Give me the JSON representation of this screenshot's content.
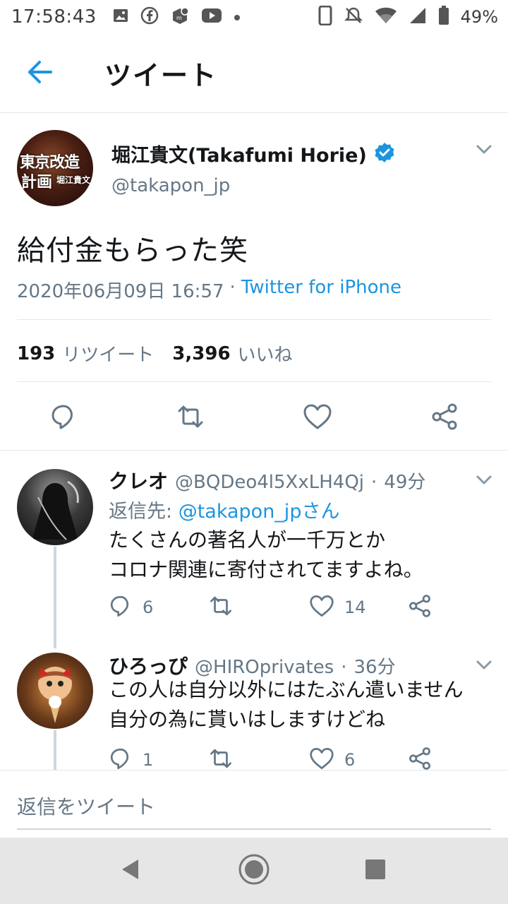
{
  "status_bar": {
    "time": "17:58:43",
    "battery": "49%",
    "icons": [
      "gallery-icon",
      "facebook-icon",
      "shop-icon",
      "youtube-icon",
      "dot-icon",
      "phone-icon",
      "mute-icon",
      "wifi-icon",
      "signal-icon",
      "battery-icon"
    ]
  },
  "header": {
    "title": "ツイート",
    "back_icon": "back-arrow-icon"
  },
  "main_tweet": {
    "avatar_text_1": "東京改造",
    "avatar_text_2": "計画",
    "avatar_text_3": "堀江貴文",
    "name": "堀江貴文(Takafumi Horie)",
    "handle": "@takapon_jp",
    "verified": true,
    "text": "給付金もらった笑",
    "datetime": "2020年06月09日 16:57",
    "separator": "·",
    "source": "Twitter for iPhone",
    "retweets": "193",
    "retweets_label": "リツイート",
    "likes": "3,396",
    "likes_label": "いいね",
    "accent_color": "#1b95e0"
  },
  "replies": [
    {
      "name": "クレオ",
      "handle": "@BQDeo4l5XxLH4Qj",
      "separator": "·",
      "time": "49分",
      "reply_to_label": "返信先:",
      "reply_to": "@takapon_jpさん",
      "text_line1": "たくさんの著名人が一千万とか",
      "text_line2": "コロナ関連に寄付されてますよね。",
      "replies": "6",
      "retweets": "",
      "likes": "14"
    },
    {
      "name": "ひろっぴ",
      "handle": "@HIROprivates",
      "separator": "·",
      "time": "36分",
      "text_line1": "この人は自分以外にはたぶん遣いません",
      "text_line2": "自分の為に貰いはしますけどね",
      "replies": "1",
      "retweets": "",
      "likes": "6"
    }
  ],
  "compose": {
    "placeholder": "返信をツイート"
  },
  "nav_bar": {
    "buttons": [
      "back-triangle-icon",
      "home-circle-icon",
      "recents-square-icon"
    ]
  }
}
